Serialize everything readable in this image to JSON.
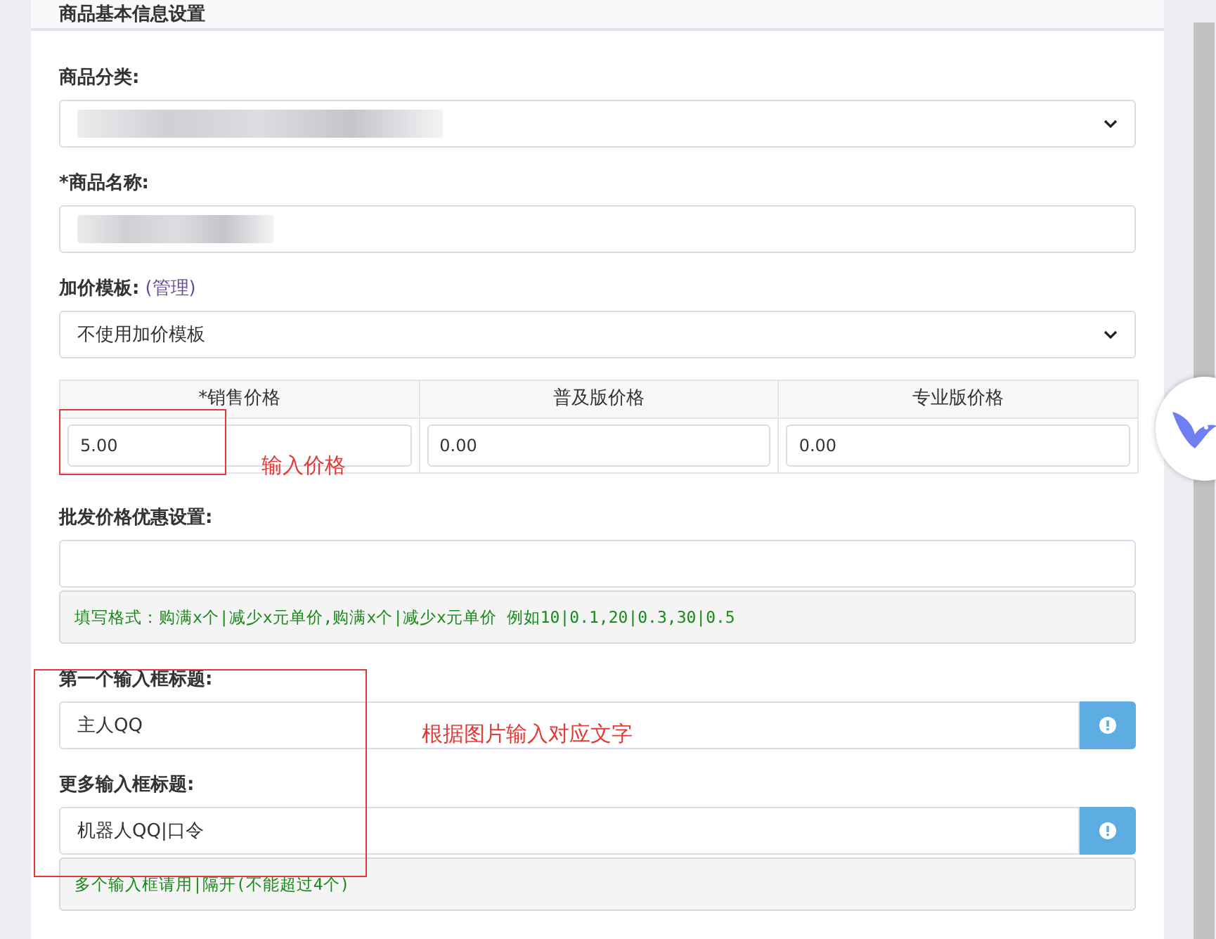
{
  "panel": {
    "title": "商品基本信息设置"
  },
  "fields": [
    {
      "kind": "select-redacted",
      "label": "商品分类:"
    },
    {
      "kind": "input-redacted",
      "label": "*商品名称:"
    },
    {
      "kind": "select",
      "label": "加价模板:",
      "label_link": "(管理)",
      "value": "不使用加价模板"
    },
    {
      "kind": "prices",
      "columns": [
        {
          "header": "*销售价格",
          "value": "5.00"
        },
        {
          "header": "普及版价格",
          "value": "0.00"
        },
        {
          "header": "专业版价格",
          "value": "0.00"
        }
      ]
    },
    {
      "kind": "input",
      "label": "批发价格优惠设置:",
      "hint": "填写格式：购满x个|减少x元单价,购满x个|减少x元单价  例如10|0.1,20|0.3,30|0.5"
    },
    {
      "kind": "input-button",
      "label": "第一个输入框标题:",
      "value": "主人QQ"
    },
    {
      "kind": "input-button",
      "label": "更多输入框标题:",
      "value": "机器人QQ|口令",
      "hint": "多个输入框请用|隔开(不能超过4个)"
    }
  ],
  "annotations": [
    {
      "text": "输入价格"
    },
    {
      "text": "根据图片输入对应文字"
    }
  ]
}
